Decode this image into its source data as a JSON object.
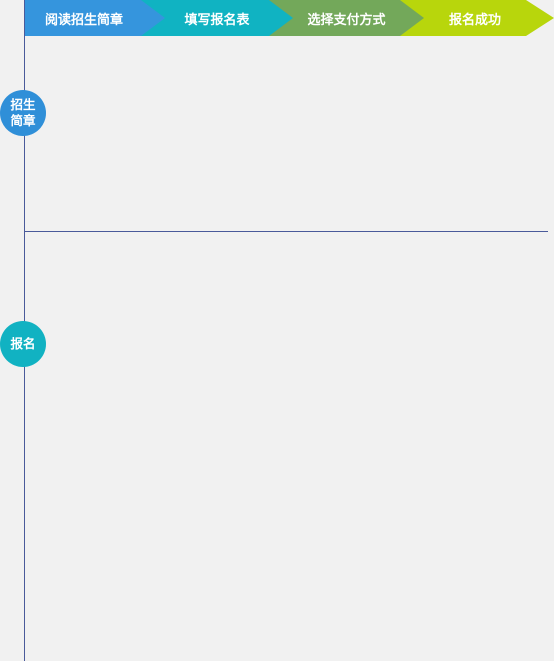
{
  "steps": [
    {
      "label": "阅读招生简章",
      "color": "#3595dd"
    },
    {
      "label": "填写报名表",
      "color": "#10b3c2"
    },
    {
      "label": "选择支付方式",
      "color": "#73a85a"
    },
    {
      "label": "报名成功",
      "color": "#b8d60c"
    }
  ],
  "timeline": {
    "nodes": [
      {
        "label": "招生简章",
        "color": "#2f8fd8"
      },
      {
        "label": "报名",
        "color": "#11b2c2"
      }
    ],
    "line_color": "#4a5a9a"
  },
  "background_color": "#f1f1f1"
}
